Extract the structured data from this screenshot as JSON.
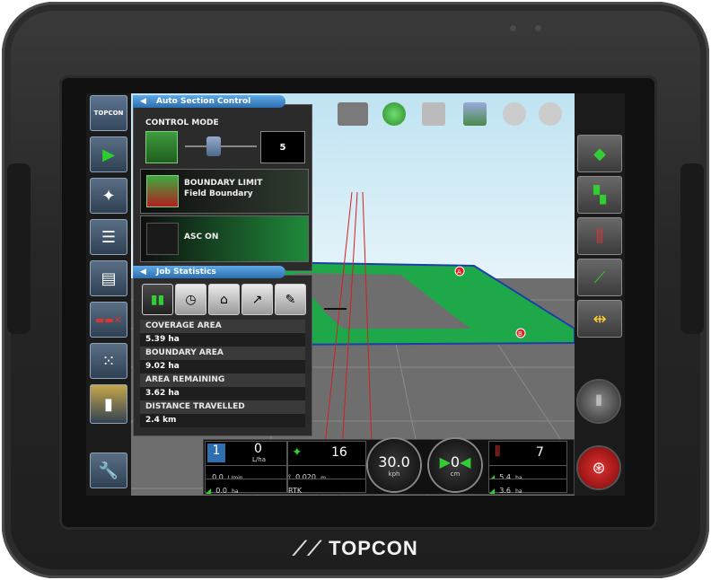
{
  "brand": "TOPCON",
  "nav": {
    "top_logo": "TOPCON",
    "items": [
      "guidance-icon",
      "satellite-icon",
      "list-icon",
      "document-icon",
      "boom-sections-icon",
      "sprayer-icon",
      "tank-icon",
      "wrench-icon"
    ]
  },
  "asc": {
    "title": "Auto Section Control",
    "control_mode_label": "CONTROL MODE",
    "control_mode_value": "5",
    "boundary_limit_label": "BOUNDARY LIMIT",
    "boundary_limit_value": "Field Boundary",
    "asc_status": "ASC ON"
  },
  "job_stats": {
    "title": "Job Statistics",
    "rows": [
      {
        "label": "COVERAGE AREA",
        "value": "5.39 ha"
      },
      {
        "label": "BOUNDARY AREA",
        "value": "9.02 ha"
      },
      {
        "label": "AREA REMAINING",
        "value": "3.62 ha"
      },
      {
        "label": "DISTANCE TRAVELLED",
        "value": "2.4 km"
      }
    ]
  },
  "map": {
    "marker_a": "A",
    "marker_b": "B"
  },
  "bottom": {
    "rate_section": "1",
    "rate_value": "0",
    "rate_unit": "L/ha",
    "flow_value": "0.0",
    "flow_unit": "L/min",
    "applied_value": "0.0",
    "applied_unit": "ha",
    "satellites": "16",
    "accuracy_value": "0.020",
    "accuracy_unit": "m",
    "gps_mode": "RTK",
    "speed_value": "30.0",
    "speed_unit": "kph",
    "offline_value": "0",
    "offline_unit": "cm",
    "sections_count": "7",
    "area1_value": "5.4",
    "area1_unit": "ha",
    "area2_value": "3.6",
    "area2_unit": "ha"
  },
  "colors": {
    "accent_blue": "#2d6fb0",
    "coverage_green": "#1fa84a",
    "stop_red": "#c8102e"
  }
}
